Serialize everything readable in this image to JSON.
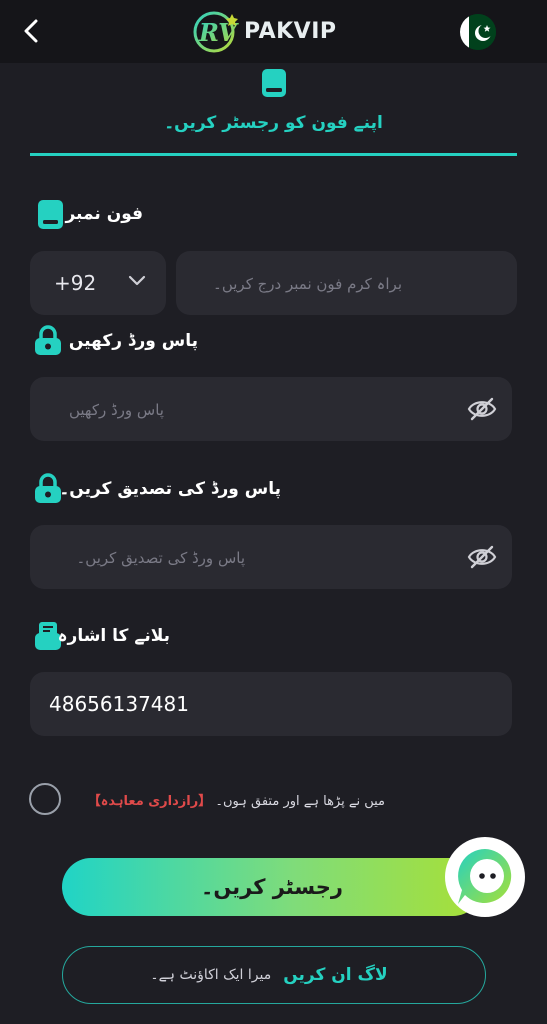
{
  "header": {
    "brand": "PAKVIP",
    "back_icon": "chevron-left-icon",
    "flag_icon": "pakistan-flag-icon"
  },
  "tab": {
    "label": "اپنے فون کو رجسٹر کریں۔",
    "icon": "phone-icon",
    "accent_color": "#25d1c1"
  },
  "form": {
    "phone": {
      "label": "فون نمبر",
      "country_code": "+92",
      "placeholder": "براہ کرم فون نمبر درج کریں۔"
    },
    "password": {
      "label": "پاس ورڈ رکھیں",
      "placeholder": "پاس ورڈ رکھیں"
    },
    "confirm_password": {
      "label": "پاس ورڈ کی تصدیق کریں۔",
      "placeholder": "پاس ورڈ کی تصدیق کریں۔"
    },
    "invite": {
      "label": "بلانے کا اشارہ",
      "value": "48656137481"
    }
  },
  "agreement": {
    "text": "میں نے پڑھا ہے اور متفق ہوں۔",
    "link": "【رازداری معاہدہ】",
    "link_color": "#e04a4a"
  },
  "actions": {
    "register_label": "رجسٹر کریں۔",
    "login_text": "میرا ایک اکاؤنٹ ہے۔",
    "login_link": "لاگ ان کریں"
  }
}
